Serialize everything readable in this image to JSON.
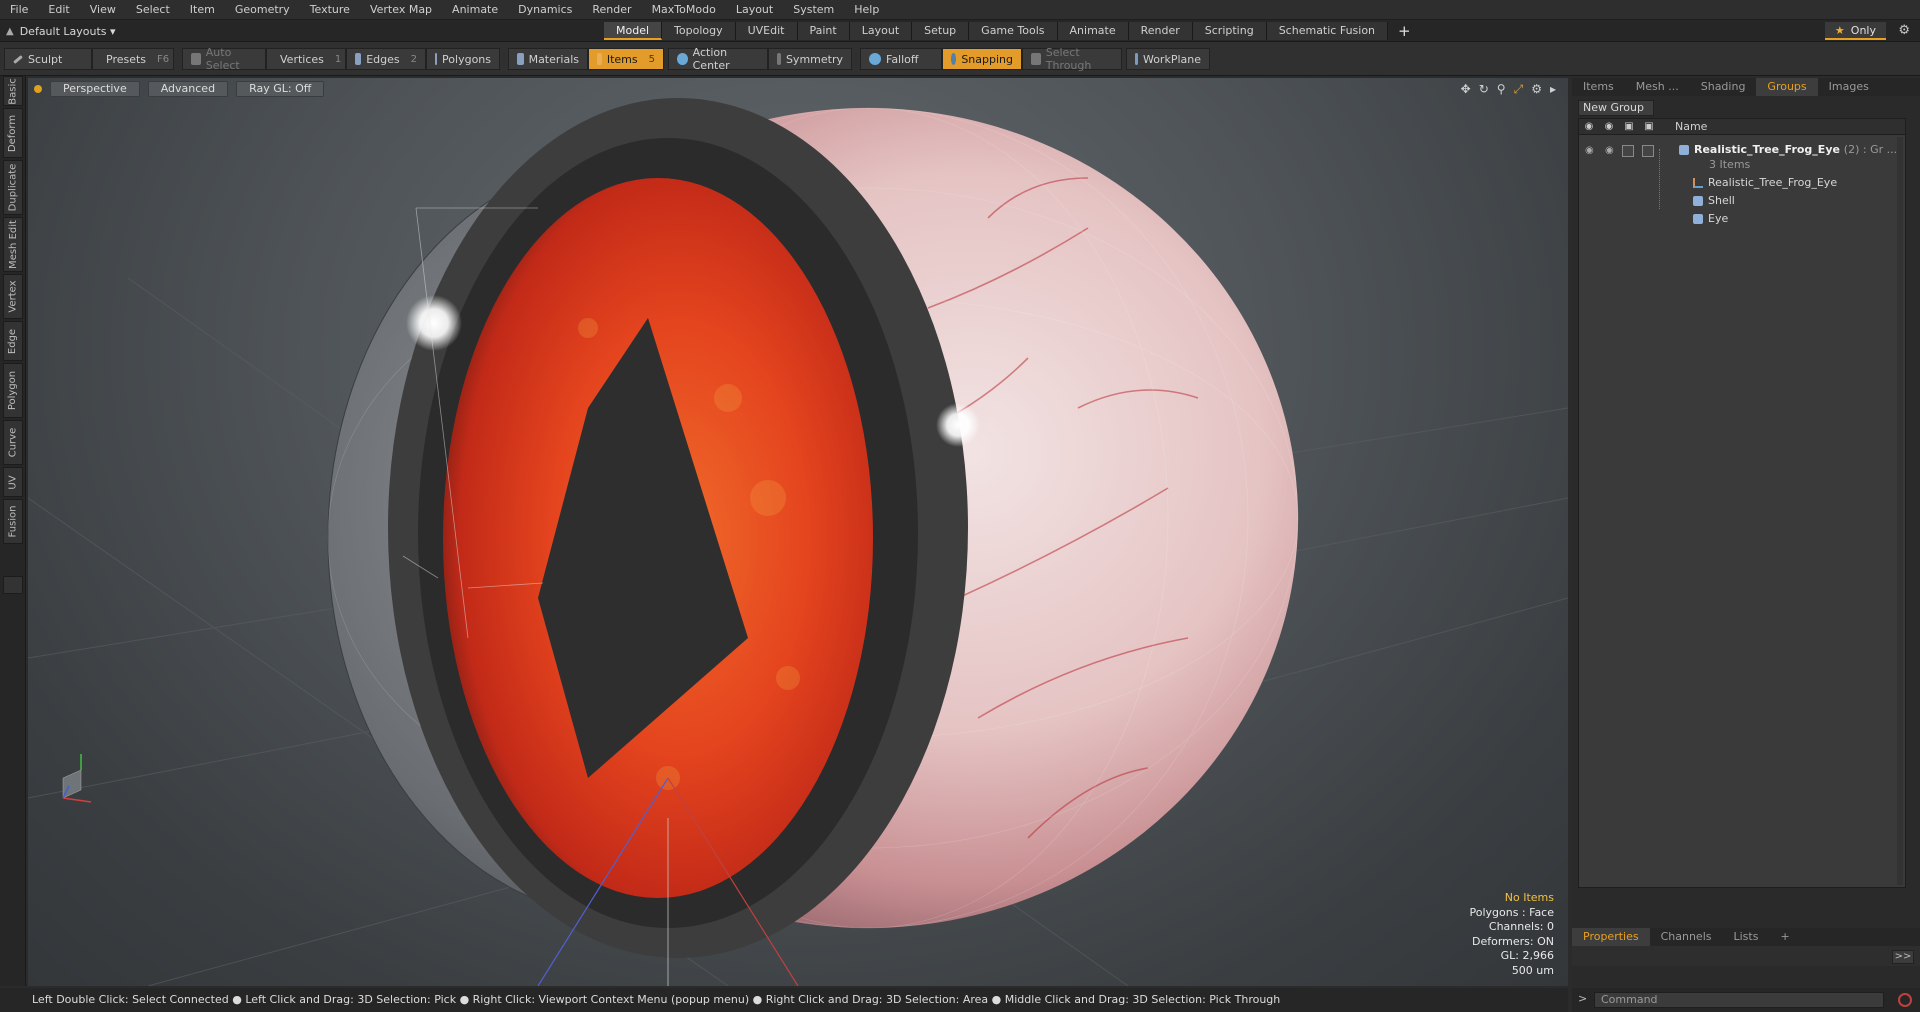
{
  "menu": [
    "File",
    "Edit",
    "View",
    "Select",
    "Item",
    "Geometry",
    "Texture",
    "Vertex Map",
    "Animate",
    "Dynamics",
    "Render",
    "MaxToModo",
    "Layout",
    "System",
    "Help"
  ],
  "layout_select": "Default Layouts ▾",
  "tabs": [
    "Model",
    "Topology",
    "UVEdit",
    "Paint",
    "Layout",
    "Setup",
    "Game Tools",
    "Animate",
    "Render",
    "Scripting",
    "Schematic Fusion"
  ],
  "tab_plus": "+",
  "only_label": "Only",
  "toolbar": {
    "sculpt": "Sculpt",
    "presets": "Presets",
    "presets_key": "F6",
    "auto_select": "Auto Select",
    "vertices": "Vertices",
    "vertices_key": "1",
    "edges": "Edges",
    "edges_key": "2",
    "polygons": "Polygons",
    "materials": "Materials",
    "items": "Items",
    "items_key": "5",
    "action_center": "Action Center",
    "symmetry": "Symmetry",
    "falloff": "Falloff",
    "snapping": "Snapping",
    "select_through": "Select Through",
    "workplane": "WorkPlane"
  },
  "left_tabs": [
    "Basic",
    "Deform",
    "Duplicate",
    "Mesh Edit",
    "Vertex",
    "Edge",
    "Polygon",
    "Curve",
    "UV",
    "Fusion"
  ],
  "viewport": {
    "perspective": "Perspective",
    "advanced": "Advanced",
    "raygl": "Ray GL: Off",
    "info": {
      "no_items": "No Items",
      "polygons": "Polygons : Face",
      "channels": "Channels: 0",
      "deformers": "Deformers: ON",
      "gl": "GL: 2,966",
      "scale": "500 um"
    }
  },
  "right_panel": {
    "tabs": [
      "Items",
      "Mesh ...",
      "Shading",
      "Groups",
      "Images"
    ],
    "active_tab": "Groups",
    "new_group": "New Group",
    "column_name": "Name",
    "group": {
      "name": "Realistic_Tree_Frog_Eye",
      "count": "(2) : Gr ...",
      "items_count": "3 Items"
    },
    "children": [
      "Realistic_Tree_Frog_Eye",
      "Shell",
      "Eye"
    ]
  },
  "bottom_tabs": [
    "Properties",
    "Channels",
    "Lists",
    "+"
  ],
  "bottom_expand": ">>",
  "status_text": "Left Double Click: Select Connected ● Left Click and Drag: 3D Selection: Pick ● Right Click: Viewport Context Menu (popup menu) ● Right Click and Drag: 3D Selection: Area ● Middle Click and Drag: 3D Selection: Pick Through",
  "command_placeholder": "Command",
  "colors": {
    "accent": "#e8a020",
    "iris": "#d8321e",
    "sclera": "#e7cfcf",
    "pupil": "#2a2a2a"
  }
}
